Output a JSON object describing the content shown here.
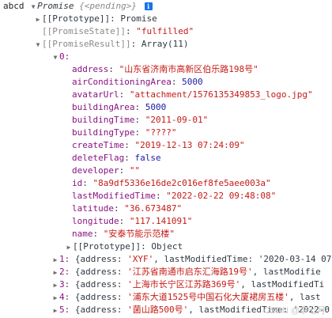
{
  "console": {
    "var_label": "abcd",
    "promise_label": "Promise",
    "pending_text": "{<pending>}",
    "info_icon": "i",
    "prototype_line": "[[Prototype]]: Promise",
    "state_key": "[[PromiseState]]",
    "state_value": "\"fulfilled\"",
    "result_key": "[[PromiseResult]]",
    "result_value": "Array(11)",
    "item0_key": "0:",
    "fields": [
      {
        "key": "address",
        "value": "\"山东省济南市高新区伯乐路198号\"",
        "type": "str"
      },
      {
        "key": "airConditioningArea",
        "value": "5000",
        "type": "num"
      },
      {
        "key": "avatarUrl",
        "value": "\"attachment/1576135349853_logo.jpg\"",
        "type": "str"
      },
      {
        "key": "buildingArea",
        "value": "5000",
        "type": "num"
      },
      {
        "key": "buildingTime",
        "value": "\"2011-09-01\"",
        "type": "str"
      },
      {
        "key": "buildingType",
        "value": "\"????\"",
        "type": "str"
      },
      {
        "key": "createTime",
        "value": "\"2019-12-13 07:24:09\"",
        "type": "str"
      },
      {
        "key": "deleteFlag",
        "value": "false",
        "type": "bool"
      },
      {
        "key": "developer",
        "value": "\"\"",
        "type": "str"
      },
      {
        "key": "id",
        "value": "\"8a9df5336e16de2c016ef8fe5aee003a\"",
        "type": "str"
      },
      {
        "key": "lastModifiedTime",
        "value": "\"2022-02-22 09:48:08\"",
        "type": "str"
      },
      {
        "key": "latitude",
        "value": "\"36.673487\"",
        "type": "str"
      },
      {
        "key": "longitude",
        "value": "\"117.141091\"",
        "type": "str"
      },
      {
        "key": "name",
        "value": "\"安泰节能示范楼\"",
        "type": "str"
      }
    ],
    "item0_proto": "[[Prototype]]: Object",
    "collapsed_items": [
      {
        "index": "1:",
        "address": "'XYF'",
        "modified": "lastModifiedTime: '2020-03-14 07"
      },
      {
        "index": "2:",
        "address": "'江苏省南通市启东汇海路19号'",
        "modified": "lastModifie"
      },
      {
        "index": "3:",
        "address": "'上海市长宁区江苏路369号'",
        "modified": "lastModifiedTi"
      },
      {
        "index": "4:",
        "address": "'浦东大道1525号中国石化大厦裙房五楼'",
        "modified": "last"
      },
      {
        "index": "5:",
        "address": "'菌山路500号'",
        "modified": "lastModifiedTime: '2022-0"
      }
    ],
    "collapsed_address_key": "{address: ",
    "collapsed_sep": ", ",
    "watermark": "CSDN @李七月"
  }
}
